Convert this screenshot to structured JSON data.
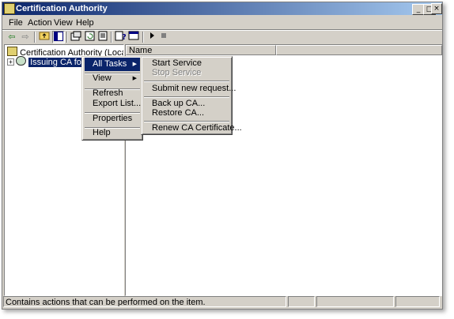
{
  "window": {
    "title": "Certification Authority"
  },
  "caption_buttons": {
    "minimize": "_",
    "maximize": "□",
    "close": "×"
  },
  "menubar": {
    "items": [
      "File",
      "Action",
      "View",
      "Help"
    ]
  },
  "toolbar": {
    "buttons": [
      "back-arrow-icon",
      "forward-arrow-icon",
      "up-folder-icon",
      "show-hide-tree-icon",
      "properties-icon",
      "refresh-icon",
      "export-list-icon",
      "help-icon",
      "console-icon",
      "start-service-icon",
      "stop-service-icon"
    ]
  },
  "tree": {
    "root_label": "Certification Authority (Local)",
    "child_label": "Issuing CA for dom",
    "expander": "+"
  },
  "list": {
    "columns": [
      "Name",
      ""
    ]
  },
  "context_menu": {
    "items": [
      {
        "label": "All Tasks",
        "submenu": true,
        "highlight": true
      },
      {
        "label": "View",
        "submenu": true
      },
      {
        "label": "Refresh"
      },
      {
        "label": "Export List..."
      },
      {
        "label": "Properties"
      },
      {
        "label": "Help"
      }
    ]
  },
  "submenu": {
    "items": [
      {
        "label": "Start Service"
      },
      {
        "label": "Stop Service",
        "disabled": true
      },
      {
        "label": "Submit new request..."
      },
      {
        "label": "Back up CA..."
      },
      {
        "label": "Restore CA..."
      },
      {
        "label": "Renew CA Certificate..."
      }
    ]
  },
  "statusbar": {
    "text": "Contains actions that can be performed on the item."
  },
  "colors": {
    "title_start": "#0a246a",
    "title_end": "#a6caf0",
    "highlight": "#0a246a",
    "face": "#d4d0c8"
  }
}
